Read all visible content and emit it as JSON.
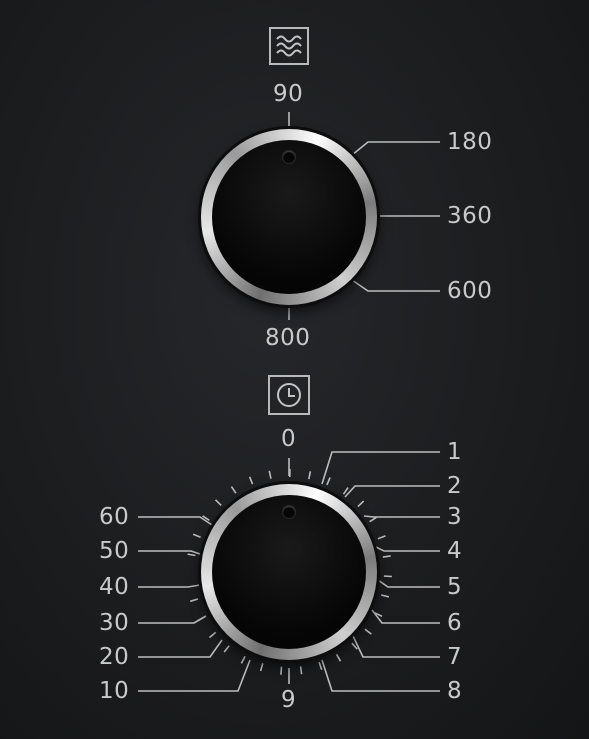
{
  "power_control": {
    "icon": "microwave-waves-icon",
    "labels": {
      "top": "90",
      "upper_right": "180",
      "right": "360",
      "lower_right": "600",
      "bottom": "800"
    }
  },
  "timer_control": {
    "icon": "clock-icon",
    "top": "0",
    "bottom": "9",
    "right": [
      "1",
      "2",
      "3",
      "4",
      "5",
      "6",
      "7",
      "8"
    ],
    "left": [
      "60",
      "50",
      "40",
      "30",
      "20",
      "10"
    ]
  }
}
